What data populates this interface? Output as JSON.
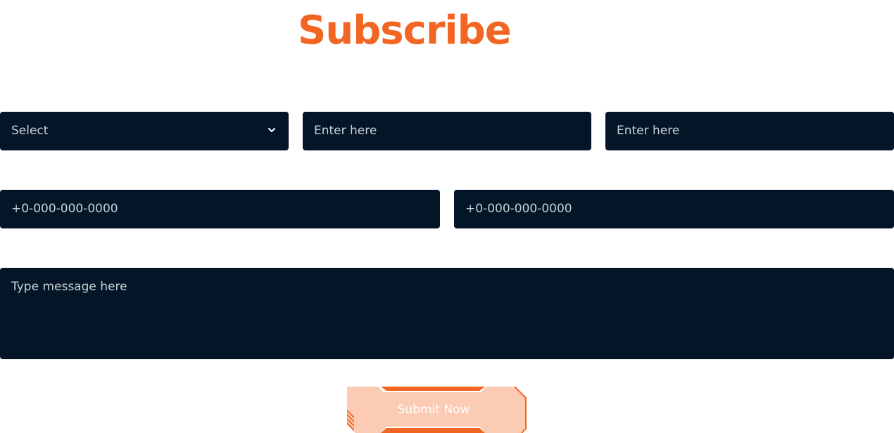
{
  "page": {
    "title": "Subscribe",
    "accent_color": "#f26522",
    "field_bg_color": "#031526"
  },
  "form": {
    "select": {
      "value": "Select",
      "icon": "chevron-down-icon"
    },
    "input_1": {
      "placeholder": "Enter here"
    },
    "input_2": {
      "placeholder": "Enter here"
    },
    "phone_1": {
      "placeholder": "+0-000-000-0000"
    },
    "phone_2": {
      "placeholder": "+0-000-000-0000"
    },
    "message": {
      "placeholder": "Type message here"
    },
    "submit": {
      "label": "Submit Now"
    }
  }
}
